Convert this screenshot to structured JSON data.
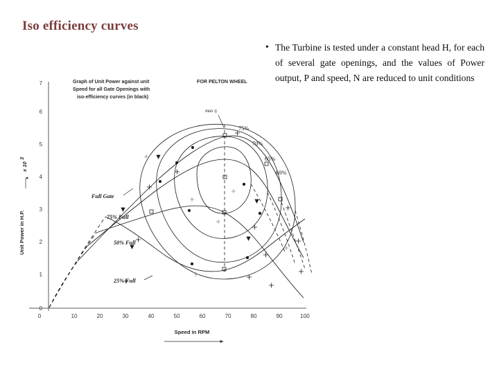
{
  "slide": {
    "title": "Iso efficiency curves",
    "title_color": "#7c3b3b",
    "background_color": "#ffffff"
  },
  "bullet": {
    "marker": "•",
    "text": "The Turbine is tested under a constant head H, for each of several gate openings, and the values of Power output, P and speed, N are reduced to unit conditions"
  },
  "figure": {
    "caption_lines": [
      "Graph of Unit Power against unit",
      "Speed for all Gate Openings with",
      "iso-efficiency curves (in black)"
    ],
    "machine_label": "FOR PELTON WHEEL",
    "max_eta_label": "max η",
    "y_axis": {
      "title": "Unit Power in H.P.",
      "multiplier": "x 10",
      "exponent": "3",
      "ticks": [
        "0",
        "1",
        "2",
        "3",
        "4",
        "5",
        "6",
        "7"
      ],
      "arrow": "up"
    },
    "x_axis": {
      "title": "Speed in RPM",
      "ticks": [
        "0",
        "10",
        "20",
        "30",
        "40",
        "50",
        "60",
        "70",
        "80",
        "90",
        "100"
      ],
      "arrow": "right"
    },
    "gate_labels": [
      "Full Gate",
      "75% Full",
      "50% Full",
      "25% Full"
    ],
    "efficiency_labels": [
      "75%",
      "70%",
      "65%",
      "60%"
    ]
  },
  "chart_data": {
    "type": "line",
    "title": "Graph of Unit Power against unit Speed for all Gate Openings with iso-efficiency curves (in black)",
    "subtitle": "FOR PELTON WHEEL",
    "xlabel": "Speed in RPM",
    "ylabel": "Unit Power in H.P. (x 10^3)",
    "xlim": [
      0,
      107
    ],
    "ylim": [
      0,
      7
    ],
    "x_ticks": [
      0,
      10,
      20,
      30,
      40,
      50,
      60,
      70,
      80,
      90,
      100
    ],
    "y_ticks": [
      0,
      1,
      2,
      3,
      4,
      5,
      6,
      7
    ],
    "grid": false,
    "legend": "inline-annotations",
    "annotations": [
      "max η"
    ],
    "series": [
      {
        "name": "Full Gate",
        "style": "solid-with-dashed-origin-segment",
        "x": [
          4,
          12,
          20,
          28,
          36,
          44,
          52,
          60,
          68,
          72,
          78,
          86,
          94,
          100,
          106
        ],
        "y": [
          0.35,
          1.25,
          2.15,
          3.0,
          3.8,
          4.5,
          5.0,
          5.25,
          5.35,
          5.3,
          5.05,
          4.4,
          3.45,
          2.6,
          1.75
        ]
      },
      {
        "name": "75% Full",
        "style": "solid-with-dashed-origin-segment",
        "x": [
          4,
          12,
          20,
          28,
          36,
          44,
          52,
          60,
          68,
          72,
          78,
          86,
          94,
          100,
          106
        ],
        "y": [
          0.3,
          1.05,
          1.8,
          2.55,
          3.2,
          3.8,
          4.25,
          4.5,
          4.55,
          4.5,
          4.25,
          3.65,
          2.85,
          2.1,
          1.35
        ]
      },
      {
        "name": "50% Full",
        "style": "solid-with-dashed-origin-segment",
        "x": [
          4,
          12,
          20,
          28,
          36,
          44,
          52,
          60,
          68,
          72,
          78,
          86,
          94,
          100,
          106
        ],
        "y": [
          0.2,
          0.7,
          1.2,
          1.7,
          2.12,
          2.5,
          2.78,
          2.9,
          2.92,
          2.88,
          2.7,
          2.3,
          1.78,
          1.28,
          0.78
        ]
      },
      {
        "name": "25% Full",
        "style": "solid-with-dashed-origin-segment",
        "x": [
          4,
          12,
          20,
          28,
          36,
          44,
          52,
          60,
          68,
          72,
          78,
          86,
          94,
          100,
          106
        ],
        "y": [
          0.12,
          0.42,
          0.72,
          1.0,
          1.25,
          1.48,
          1.63,
          1.72,
          1.74,
          1.7,
          1.58,
          1.32,
          1.0,
          0.72,
          0.45
        ]
      }
    ],
    "iso_efficiency_contours": [
      {
        "label": "75%",
        "center_x": 67,
        "center_y": 3.6,
        "width": 12,
        "height": 1.7
      },
      {
        "label": "70%",
        "center_x": 67,
        "center_y": 3.6,
        "width": 24,
        "height": 3.0
      },
      {
        "label": "65%",
        "center_x": 67,
        "center_y": 3.6,
        "width": 36,
        "height": 4.1
      },
      {
        "label": "60%",
        "center_x": 67,
        "center_y": 3.6,
        "width": 48,
        "height": 4.9
      }
    ]
  }
}
